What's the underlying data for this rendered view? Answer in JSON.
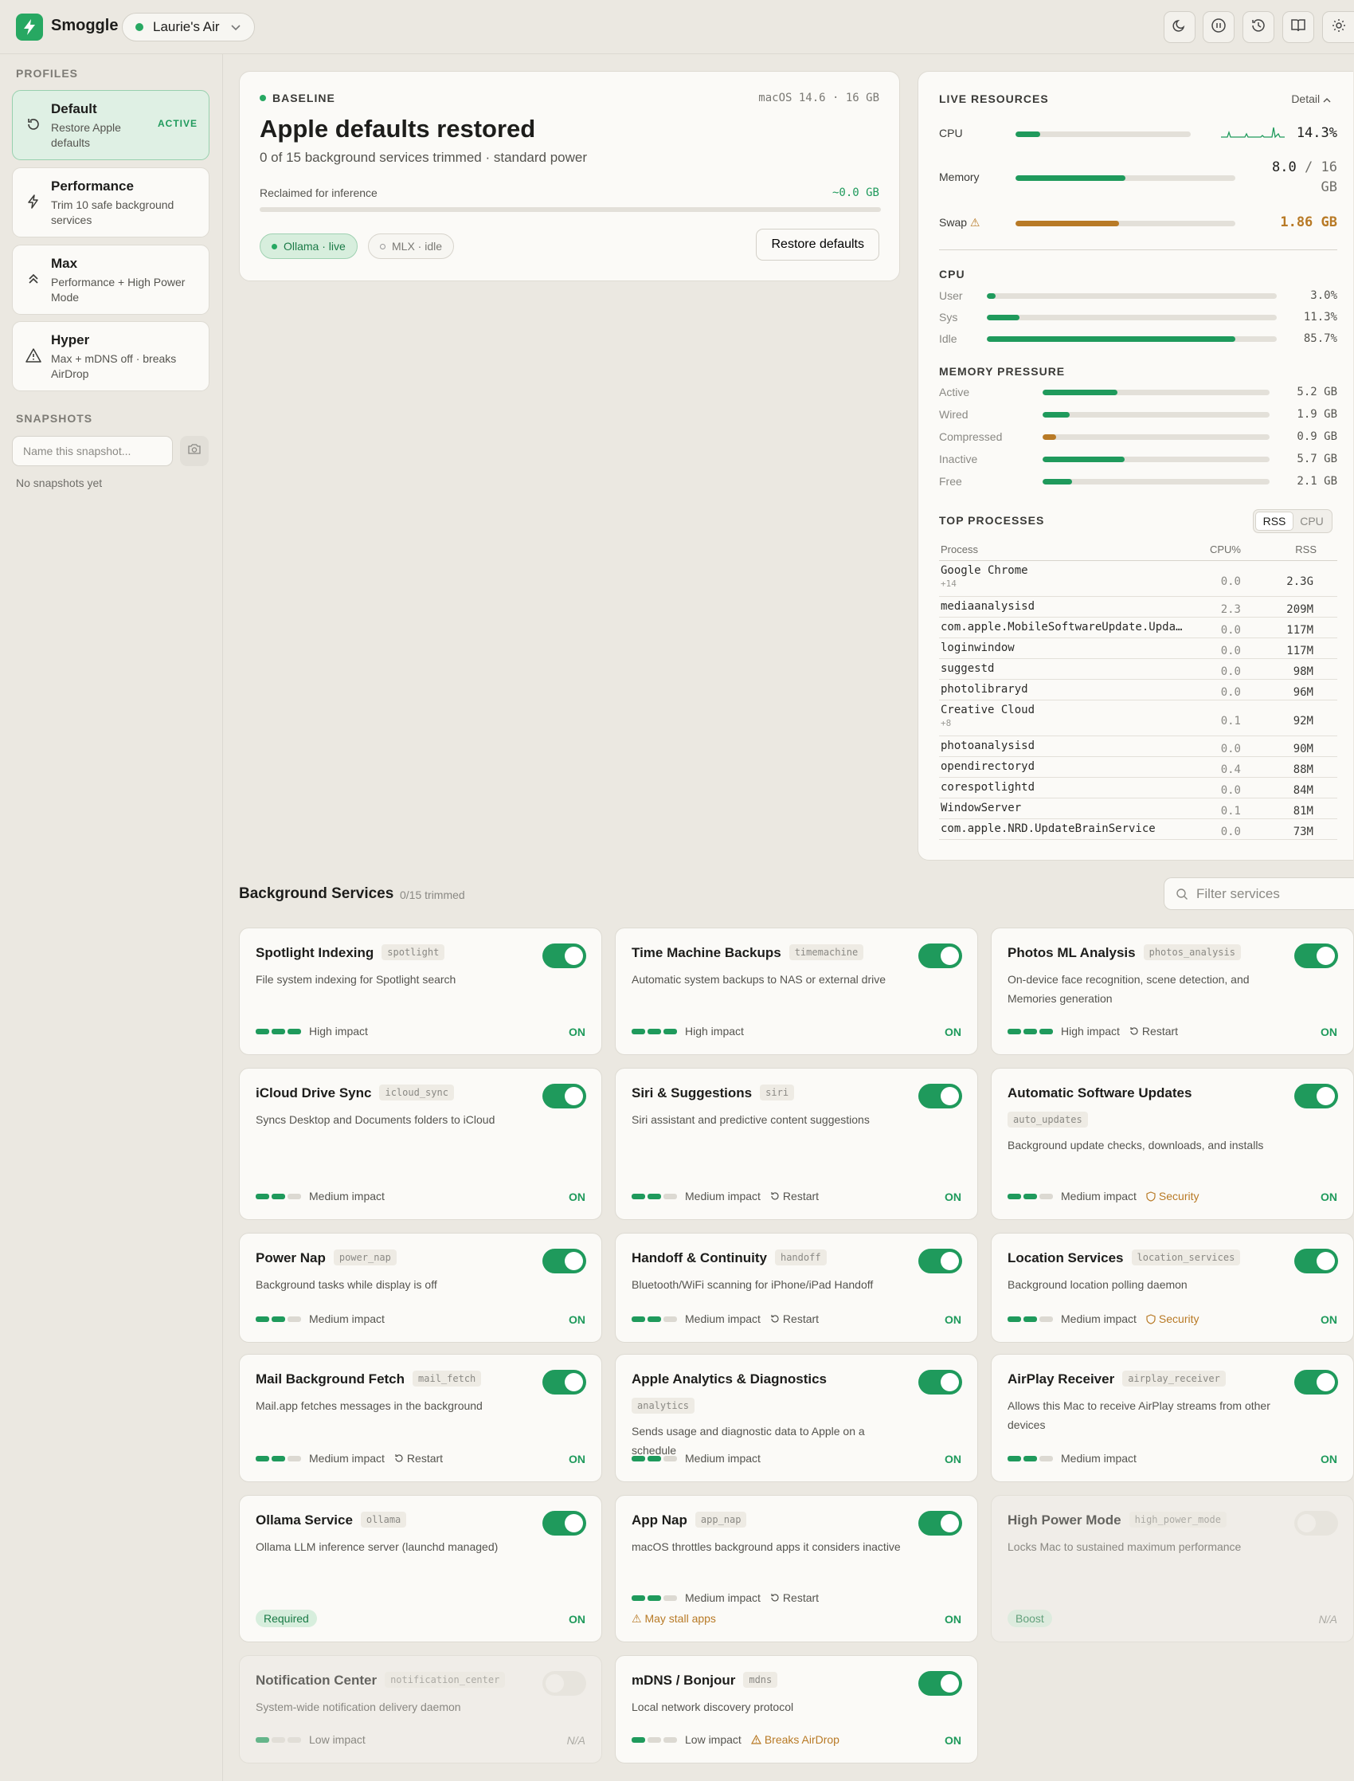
{
  "app": {
    "name": "Smoggle",
    "device": "Laurie's Air"
  },
  "toolbar": {
    "icons": [
      "moon-icon",
      "pause-icon",
      "history-icon",
      "book-icon",
      "gear-icon"
    ]
  },
  "sidebar": {
    "profiles_heading": "PROFILES",
    "profiles": [
      {
        "title": "Default",
        "desc": "Restore Apple defaults",
        "badge": "ACTIVE",
        "icon": "restore-icon"
      },
      {
        "title": "Performance",
        "desc": "Trim 10 safe background services",
        "badge": "",
        "icon": "bolt-icon"
      },
      {
        "title": "Max",
        "desc": "Performance + High Power Mode",
        "badge": "",
        "icon": "double-chevron-up-icon"
      },
      {
        "title": "Hyper",
        "desc": "Max + mDNS off · breaks AirDrop",
        "badge": "",
        "icon": "warning-icon"
      }
    ],
    "snapshots_heading": "SNAPSHOTS",
    "snapshot_placeholder": "Name this snapshot...",
    "no_snapshots": "No snapshots yet"
  },
  "baseline": {
    "tag": "BASELINE",
    "system": "macOS 14.6 · 16 GB",
    "title": "Apple defaults restored",
    "subtitle": "0 of 15 background services trimmed · standard power",
    "reclaimed_label": "Reclaimed for inference",
    "reclaimed_value": "~0.0 GB",
    "reclaimed_fraction": 0,
    "chips": [
      {
        "label": "Ollama · live"
      },
      {
        "label": "MLX · idle"
      }
    ],
    "restore_button": "Restore defaults"
  },
  "live": {
    "heading": "LIVE RESOURCES",
    "detail": "Detail",
    "cpu": {
      "label": "CPU",
      "value": "14.3%",
      "fraction": 0.143
    },
    "memory": {
      "label": "Memory",
      "used": "8.0",
      "sep": "/",
      "total": "16",
      "unit": "GB",
      "fraction": 0.5
    },
    "swap": {
      "label": "Swap",
      "value": "1.86 GB",
      "fraction": 0.47
    },
    "cpu_heading": "CPU",
    "cpu_rows": [
      {
        "label": "User",
        "value": "3.0%",
        "fraction": 0.03
      },
      {
        "label": "Sys",
        "value": "11.3%",
        "fraction": 0.113
      },
      {
        "label": "Idle",
        "value": "85.7%",
        "fraction": 0.857
      }
    ],
    "mem_heading": "MEMORY PRESSURE",
    "mem_rows": [
      {
        "label": "Active",
        "value": "5.2 GB",
        "fraction": 0.33,
        "color": "#1f9a5c"
      },
      {
        "label": "Wired",
        "value": "1.9 GB",
        "fraction": 0.12,
        "color": "#1f9a5c"
      },
      {
        "label": "Compressed",
        "value": "0.9 GB",
        "fraction": 0.06,
        "color": "#b87a26"
      },
      {
        "label": "Inactive",
        "value": "5.7 GB",
        "fraction": 0.36,
        "color": "#1f9a5c"
      },
      {
        "label": "Free",
        "value": "2.1 GB",
        "fraction": 0.13,
        "color": "#1f9a5c"
      }
    ],
    "proc_heading": "TOP PROCESSES",
    "sort": [
      "RSS",
      "CPU"
    ],
    "proc_cols": [
      "Process",
      "CPU%",
      "RSS"
    ],
    "processes": [
      {
        "name": "Google Chrome",
        "sub": "+14",
        "cpu": "0.0",
        "rss": "2.3G"
      },
      {
        "name": "mediaanalysisd",
        "sub": "",
        "cpu": "2.3",
        "rss": "209M"
      },
      {
        "name": "com.apple.MobileSoftwareUpdate.UpdateBrainService",
        "sub": "",
        "cpu": "0.0",
        "rss": "117M"
      },
      {
        "name": "loginwindow",
        "sub": "",
        "cpu": "0.0",
        "rss": "117M"
      },
      {
        "name": "suggestd",
        "sub": "",
        "cpu": "0.0",
        "rss": "98M"
      },
      {
        "name": "photolibraryd",
        "sub": "",
        "cpu": "0.0",
        "rss": "96M"
      },
      {
        "name": "Creative Cloud",
        "sub": "+8",
        "cpu": "0.1",
        "rss": "92M"
      },
      {
        "name": "photoanalysisd",
        "sub": "",
        "cpu": "0.0",
        "rss": "90M"
      },
      {
        "name": "opendirectoryd",
        "sub": "",
        "cpu": "0.4",
        "rss": "88M"
      },
      {
        "name": "corespotlightd",
        "sub": "",
        "cpu": "0.0",
        "rss": "84M"
      },
      {
        "name": "WindowServer",
        "sub": "",
        "cpu": "0.1",
        "rss": "81M"
      },
      {
        "name": "com.apple.NRD.UpdateBrainService",
        "sub": "",
        "cpu": "0.0",
        "rss": "73M"
      }
    ]
  },
  "services": {
    "title": "Background Services",
    "count": "0/15 trimmed",
    "filter_placeholder": "Filter services",
    "items": [
      {
        "name": "Spotlight Indexing",
        "key": "spotlight",
        "desc": "File system indexing for Spotlight search",
        "impact": "High impact",
        "level": 3,
        "extra": "",
        "state": "ON",
        "on": true
      },
      {
        "name": "Time Machine Backups",
        "key": "timemachine",
        "desc": "Automatic system backups to NAS or external drive",
        "impact": "High impact",
        "level": 3,
        "extra": "",
        "state": "ON",
        "on": true
      },
      {
        "name": "Photos ML Analysis",
        "key": "photos_analysis",
        "desc": "On-device face recognition, scene detection, and Memories generation",
        "impact": "High impact",
        "level": 3,
        "extra": "Restart",
        "state": "ON",
        "on": true
      },
      {
        "name": "iCloud Drive Sync",
        "key": "icloud_sync",
        "desc": "Syncs Desktop and Documents folders to iCloud",
        "impact": "Medium impact",
        "level": 2,
        "extra": "",
        "state": "ON",
        "on": true
      },
      {
        "name": "Siri & Suggestions",
        "key": "siri",
        "desc": "Siri assistant and predictive content suggestions",
        "impact": "Medium impact",
        "level": 2,
        "extra": "Restart",
        "state": "ON",
        "on": true
      },
      {
        "name": "Automatic Software Updates",
        "key": "auto_updates",
        "desc": "Background update checks, downloads, and installs",
        "impact": "Medium impact",
        "level": 2,
        "extra": "Security",
        "state": "ON",
        "on": true
      },
      {
        "name": "Power Nap",
        "key": "power_nap",
        "desc": "Background tasks while display is off",
        "impact": "Medium impact",
        "level": 2,
        "extra": "",
        "state": "ON",
        "on": true
      },
      {
        "name": "Handoff & Continuity",
        "key": "handoff",
        "desc": "Bluetooth/WiFi scanning for iPhone/iPad Handoff",
        "impact": "Medium impact",
        "level": 2,
        "extra": "Restart",
        "state": "ON",
        "on": true
      },
      {
        "name": "Location Services",
        "key": "location_services",
        "desc": "Background location polling daemon",
        "impact": "Medium impact",
        "level": 2,
        "extra": "Security",
        "state": "ON",
        "on": true
      },
      {
        "name": "Mail Background Fetch",
        "key": "mail_fetch",
        "desc": "Mail.app fetches messages in the background",
        "impact": "Medium impact",
        "level": 2,
        "extra": "Restart",
        "state": "ON",
        "on": true
      },
      {
        "name": "Apple Analytics & Diagnostics",
        "key": "analytics",
        "desc": "Sends usage and diagnostic data to Apple on a schedule",
        "impact": "Medium impact",
        "level": 2,
        "extra": "",
        "state": "ON",
        "on": true
      },
      {
        "name": "AirPlay Receiver",
        "key": "airplay_receiver",
        "desc": "Allows this Mac to receive AirPlay streams from other devices",
        "impact": "Medium impact",
        "level": 2,
        "extra": "",
        "state": "ON",
        "on": true
      },
      {
        "name": "Ollama Service",
        "key": "ollama",
        "desc": "Ollama LLM inference server (launchd managed)",
        "pill": "Required",
        "state": "ON",
        "on": true
      },
      {
        "name": "App Nap",
        "key": "app_nap",
        "desc": "macOS throttles background apps it considers inactive",
        "impact": "Medium impact",
        "level": 2,
        "extra": "Restart",
        "warn": "May stall apps",
        "state": "ON",
        "on": true
      },
      {
        "name": "High Power Mode",
        "key": "high_power_mode",
        "desc": "Locks Mac to sustained maximum performance",
        "pill": "Boost",
        "state": "N/A",
        "on": false
      },
      {
        "name": "Notification Center",
        "key": "notification_center",
        "desc": "System-wide notification delivery daemon",
        "impact": "Low impact",
        "level": 1,
        "extra": "",
        "state": "N/A",
        "on": false
      },
      {
        "name": "mDNS / Bonjour",
        "key": "mdns",
        "desc": "Local network discovery protocol",
        "impact": "Low impact",
        "level": 1,
        "extra": "Breaks AirDrop",
        "state": "ON",
        "on": true
      }
    ]
  }
}
